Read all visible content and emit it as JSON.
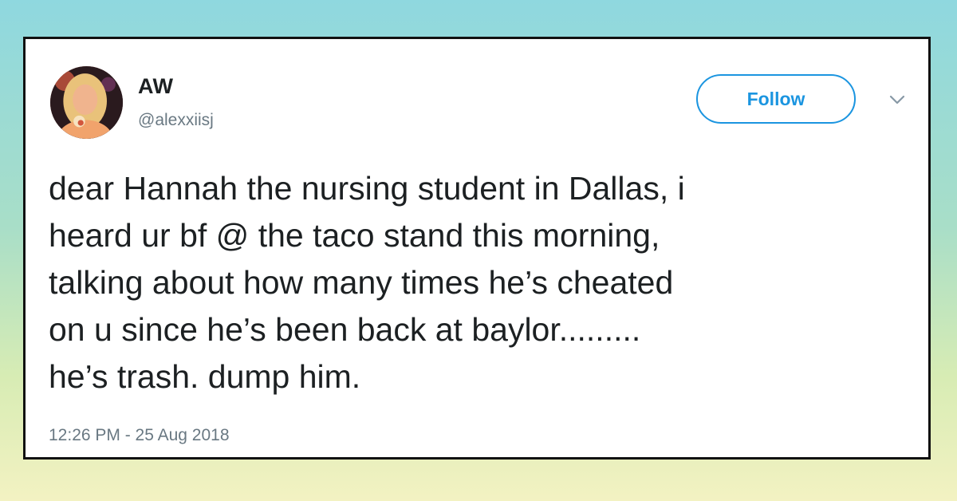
{
  "tweet": {
    "author_name": "AW",
    "author_handle": "@alexxiisj",
    "follow_label": "Follow",
    "text_lines": [
      "dear Hannah the nursing student in Dallas, i",
      "heard ur bf @ the taco stand this morning,",
      "talking about how many times he’s cheated",
      "on u since he’s been back at baylor.........",
      "he’s trash. dump him."
    ],
    "timestamp": "12:26 PM - 25 Aug 2018"
  },
  "icons": {
    "avatar": "profile-photo",
    "menu": "chevron-down-icon"
  },
  "colors": {
    "accent": "#1b95e0",
    "text": "#1c2022",
    "muted": "#697882",
    "card_border": "#111111"
  }
}
